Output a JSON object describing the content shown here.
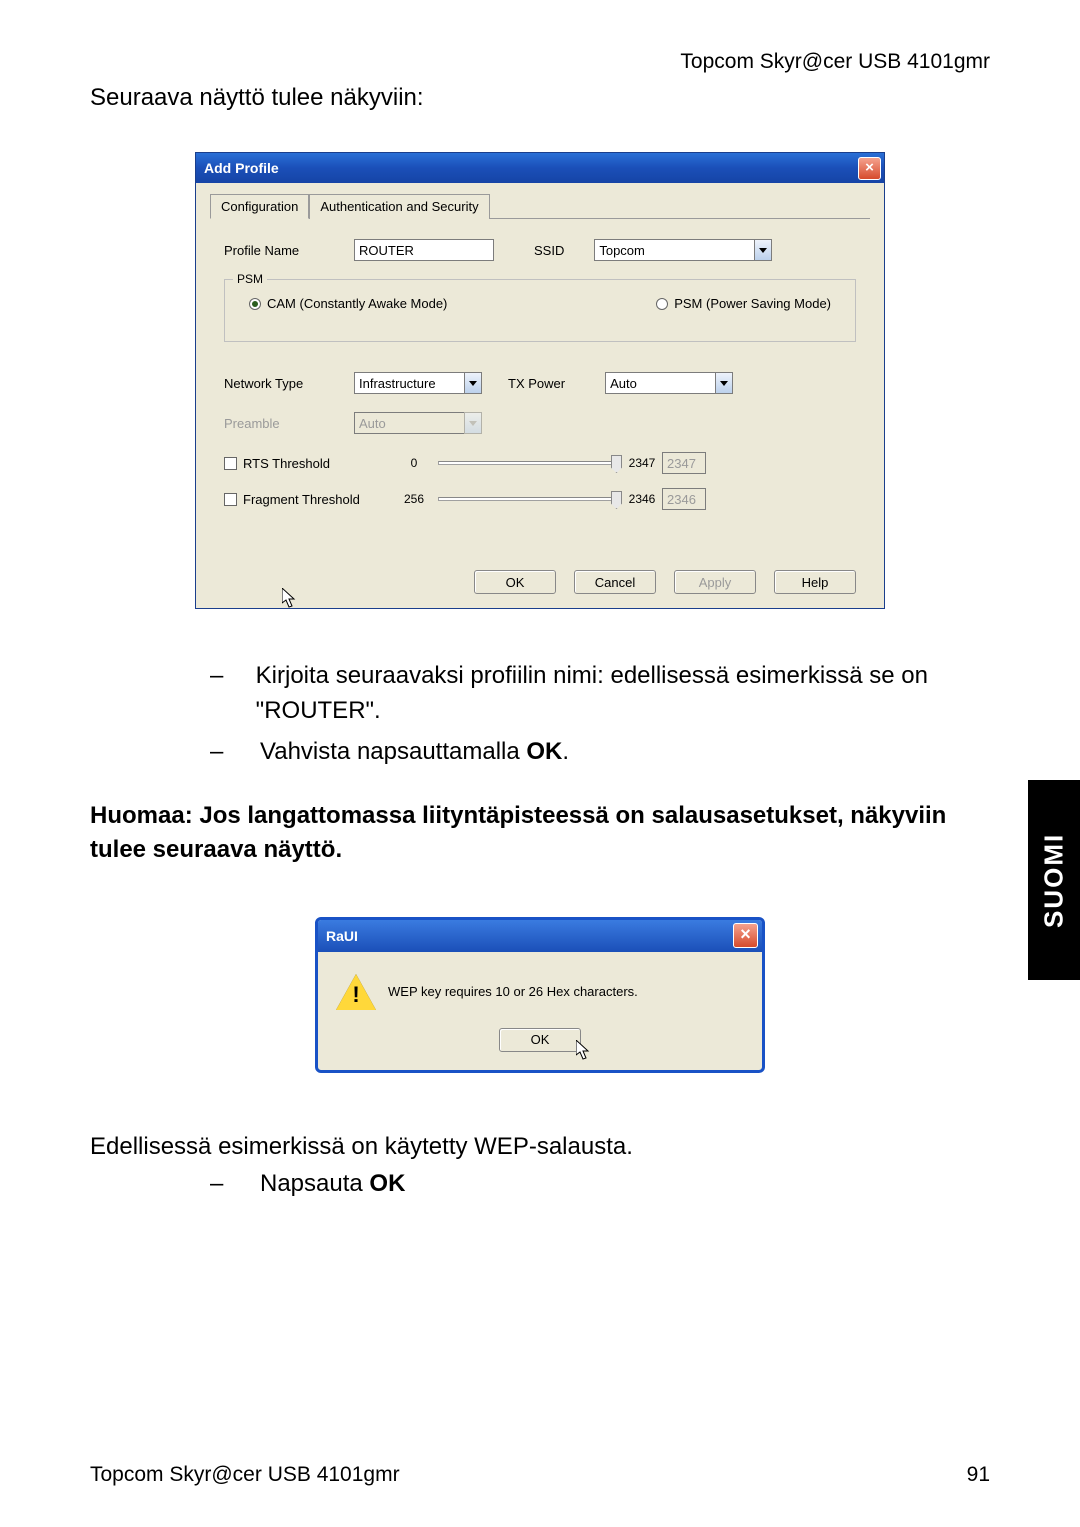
{
  "header_product": "Topcom Skyr@cer USB 4101gmr",
  "intro": "Seuraava näyttö tulee näkyviin:",
  "dialog1": {
    "title": "Add Profile",
    "close": "×",
    "tabs": {
      "config": "Configuration",
      "auth": "Authentication and Security"
    },
    "profile_name_label": "Profile Name",
    "profile_name_value": "ROUTER",
    "ssid_label": "SSID",
    "ssid_value": "Topcom",
    "psm_legend": "PSM",
    "cam_label": "CAM (Constantly Awake Mode)",
    "psm_label": "PSM (Power Saving Mode)",
    "network_type_label": "Network Type",
    "network_type_value": "Infrastructure",
    "tx_power_label": "TX Power",
    "tx_power_value": "Auto",
    "preamble_label": "Preamble",
    "preamble_value": "Auto",
    "rts_label": "RTS Threshold",
    "rts_min": "0",
    "rts_max": "2347",
    "rts_value": "2347",
    "frag_label": "Fragment Threshold",
    "frag_min": "256",
    "frag_max": "2346",
    "frag_value": "2346",
    "btn_ok": "OK",
    "btn_cancel": "Cancel",
    "btn_apply": "Apply",
    "btn_help": "Help"
  },
  "list": {
    "item1a": "Kirjoita seuraavaksi profiilin nimi: edellisessä esimerkissä se on \"ROUTER\".",
    "item2a": "Vahvista napsauttamalla ",
    "item2b": "OK",
    "item2c": "."
  },
  "note": "Huomaa: Jos langattomassa liityntäpisteessä on salausasetukset, näkyviin tulee seuraava näyttö.",
  "side_tab": "SUOMI",
  "dialog2": {
    "title": "RaUI",
    "close": "×",
    "message": "WEP key requires 10 or 26 Hex characters.",
    "btn_ok": "OK"
  },
  "outro": "Edellisessä esimerkissä on käytetty WEP-salausta.",
  "outro_item_a": "Napsauta ",
  "outro_item_b": "OK",
  "footer_left": "Topcom Skyr@cer USB 4101gmr",
  "footer_right": "91"
}
